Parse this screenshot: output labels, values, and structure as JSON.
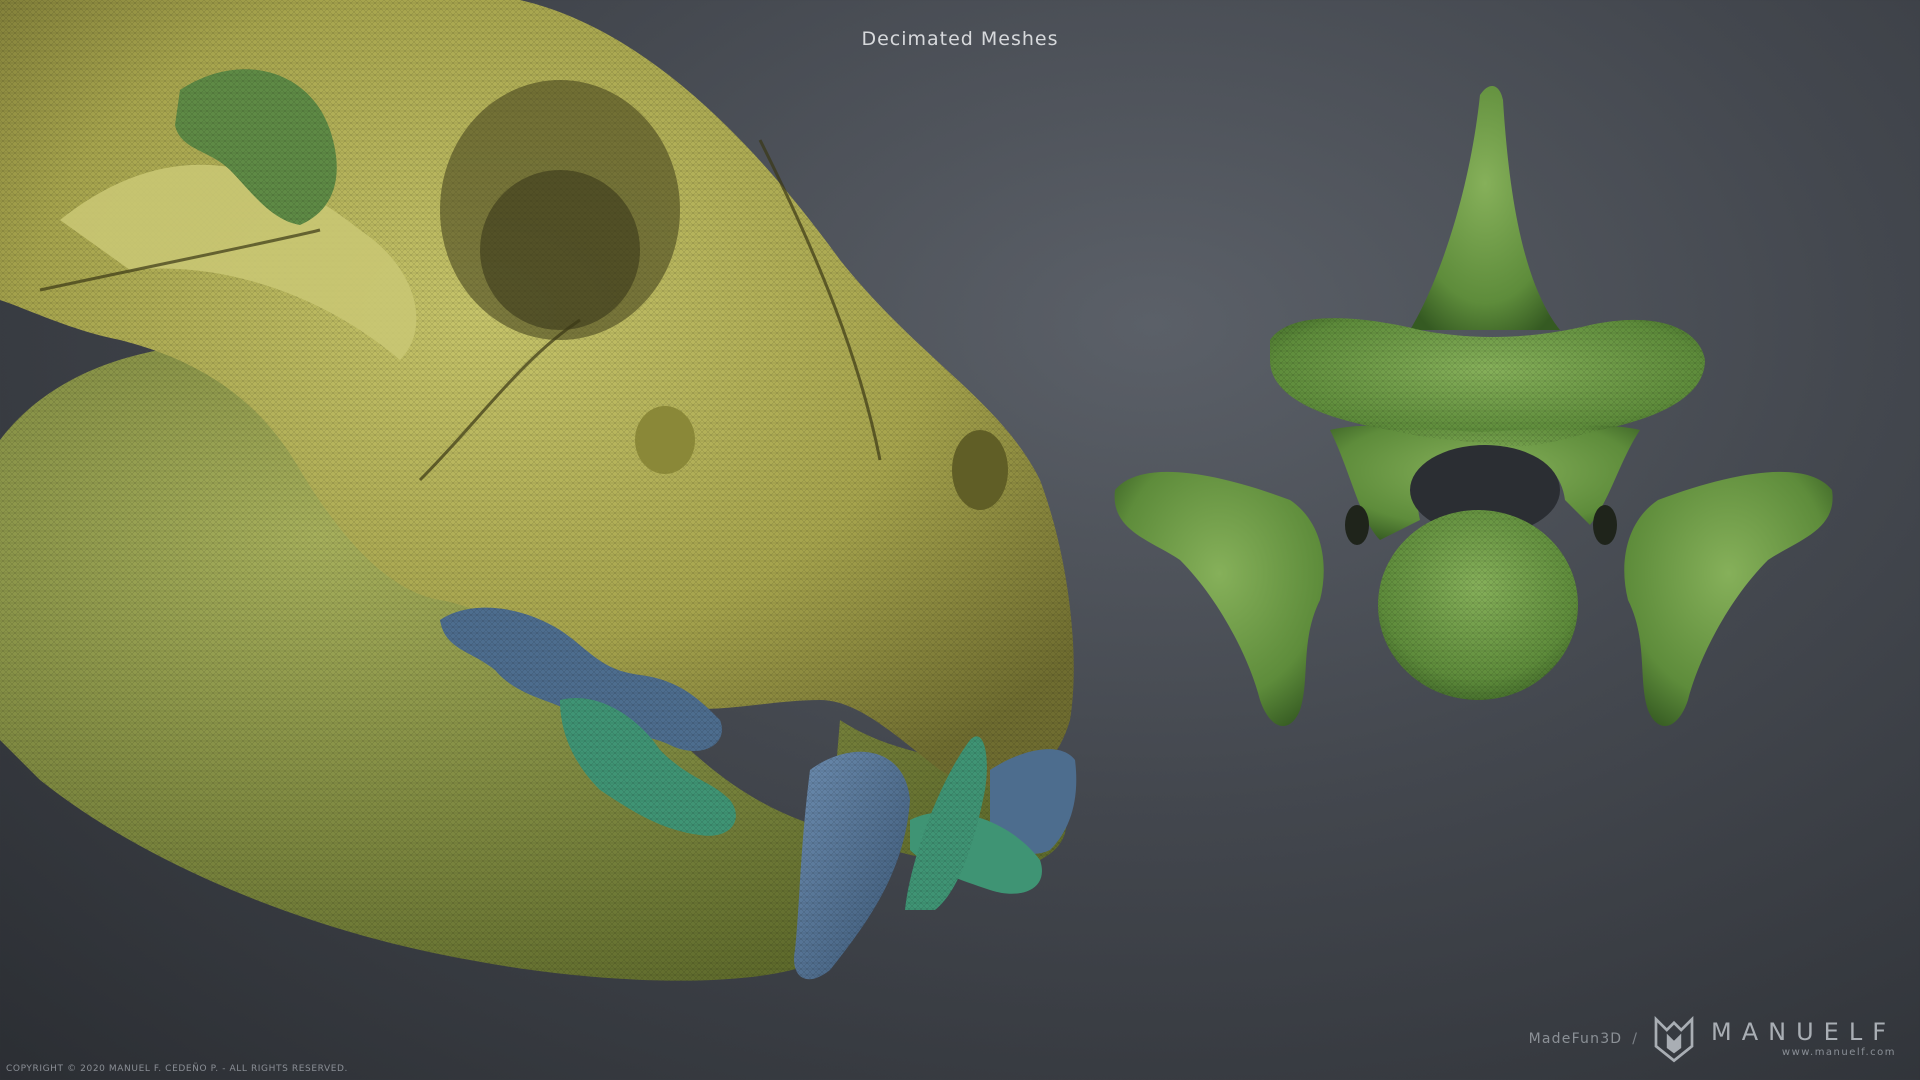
{
  "header": {
    "title": "Decimated Meshes"
  },
  "footer": {
    "copyright": "COPYRIGHT © 2020 MANUEL F. CEDEÑO P. - ALL RIGHTS RESERVED.",
    "made": "MadeFun3D",
    "slash": "/",
    "brand": "MANUELF",
    "url": "www.manuelf.com",
    "logo_icon": "manuelf-logo-icon"
  },
  "colors": {
    "background": "#43474e",
    "skull": "#b6b55a",
    "skull_shadow": "#6d6b2e",
    "vertebra": "#6a9a45",
    "vertebra_shadow": "#34521f",
    "teeth_blue": "#4d6d8e",
    "teeth_teal": "#3f9474"
  }
}
